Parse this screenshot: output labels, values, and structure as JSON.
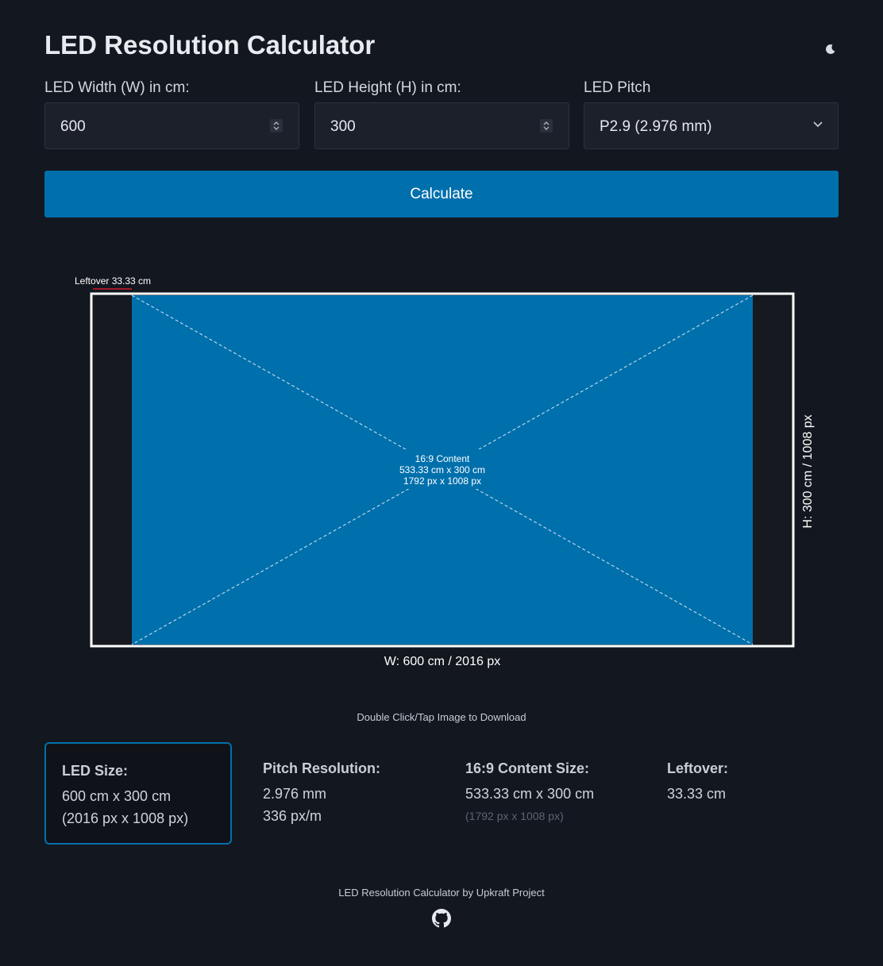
{
  "header": {
    "title": "LED Resolution Calculator",
    "theme_icon": "moon-icon"
  },
  "form": {
    "width": {
      "label": "LED Width (W) in cm:",
      "value": "600"
    },
    "height": {
      "label": "LED Height (H) in cm:",
      "value": "300"
    },
    "pitch": {
      "label": "LED Pitch",
      "selected": "P2.9 (2.976 mm)"
    },
    "calculate_label": "Calculate"
  },
  "diagram": {
    "leftover_label": "Leftover 33.33 cm",
    "content_label": "16:9 Content",
    "content_size_cm": "533.33 cm x 300 cm",
    "content_size_px": "1792 px x 1008 px",
    "width_label": "W: 600 cm / 2016 px",
    "height_label": "H: 300 cm / 1008 px",
    "colors": {
      "content": "#0070ad",
      "panel": "#16191f",
      "border": "#ffffff"
    }
  },
  "download_hint": "Double Click/Tap Image to Download",
  "results": {
    "led_size": {
      "heading": "LED Size:",
      "line1": "600 cm x 300 cm",
      "line2": "(2016 px x 1008 px)"
    },
    "pitch_resolution": {
      "heading": "Pitch Resolution:",
      "line1": "2.976 mm",
      "line2": "336 px/m"
    },
    "content_size": {
      "heading": "16:9 Content Size:",
      "line1": "533.33 cm x 300 cm",
      "line2": "(1792 px x 1008 px)"
    },
    "leftover": {
      "heading": "Leftover:",
      "line1": "33.33 cm"
    }
  },
  "footer": {
    "text": "LED Resolution Calculator by Upkraft Project",
    "icon": "github-icon"
  }
}
